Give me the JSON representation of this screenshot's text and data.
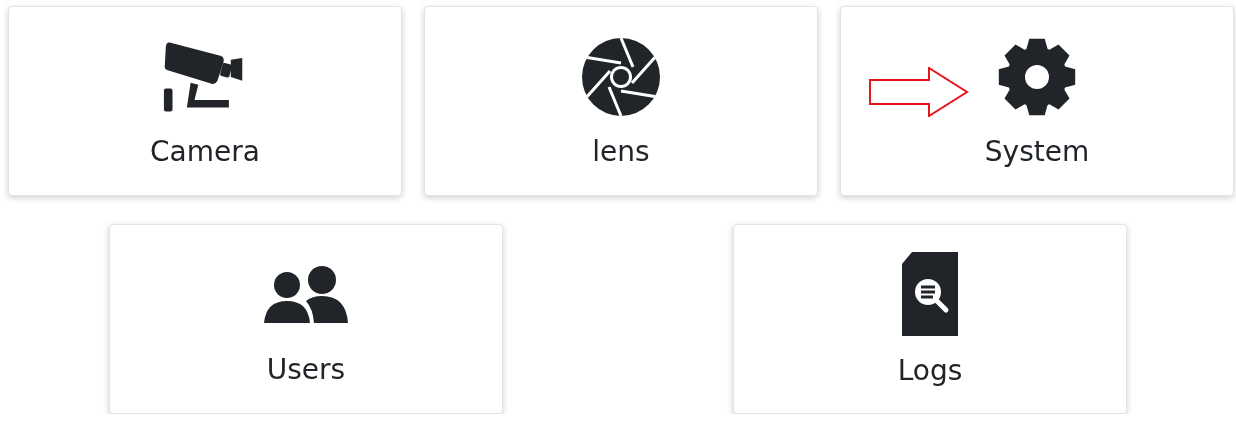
{
  "rows": [
    {
      "cards": [
        {
          "label": "Camera",
          "kind": "camera",
          "arrow": false
        },
        {
          "label": "lens",
          "kind": "aperture",
          "arrow": false
        },
        {
          "label": "System",
          "kind": "gear",
          "arrow": true
        }
      ]
    },
    {
      "cards": [
        {
          "label": "Users",
          "kind": "users",
          "arrow": false
        },
        {
          "label": "Logs",
          "kind": "logs",
          "arrow": false
        }
      ]
    }
  ]
}
